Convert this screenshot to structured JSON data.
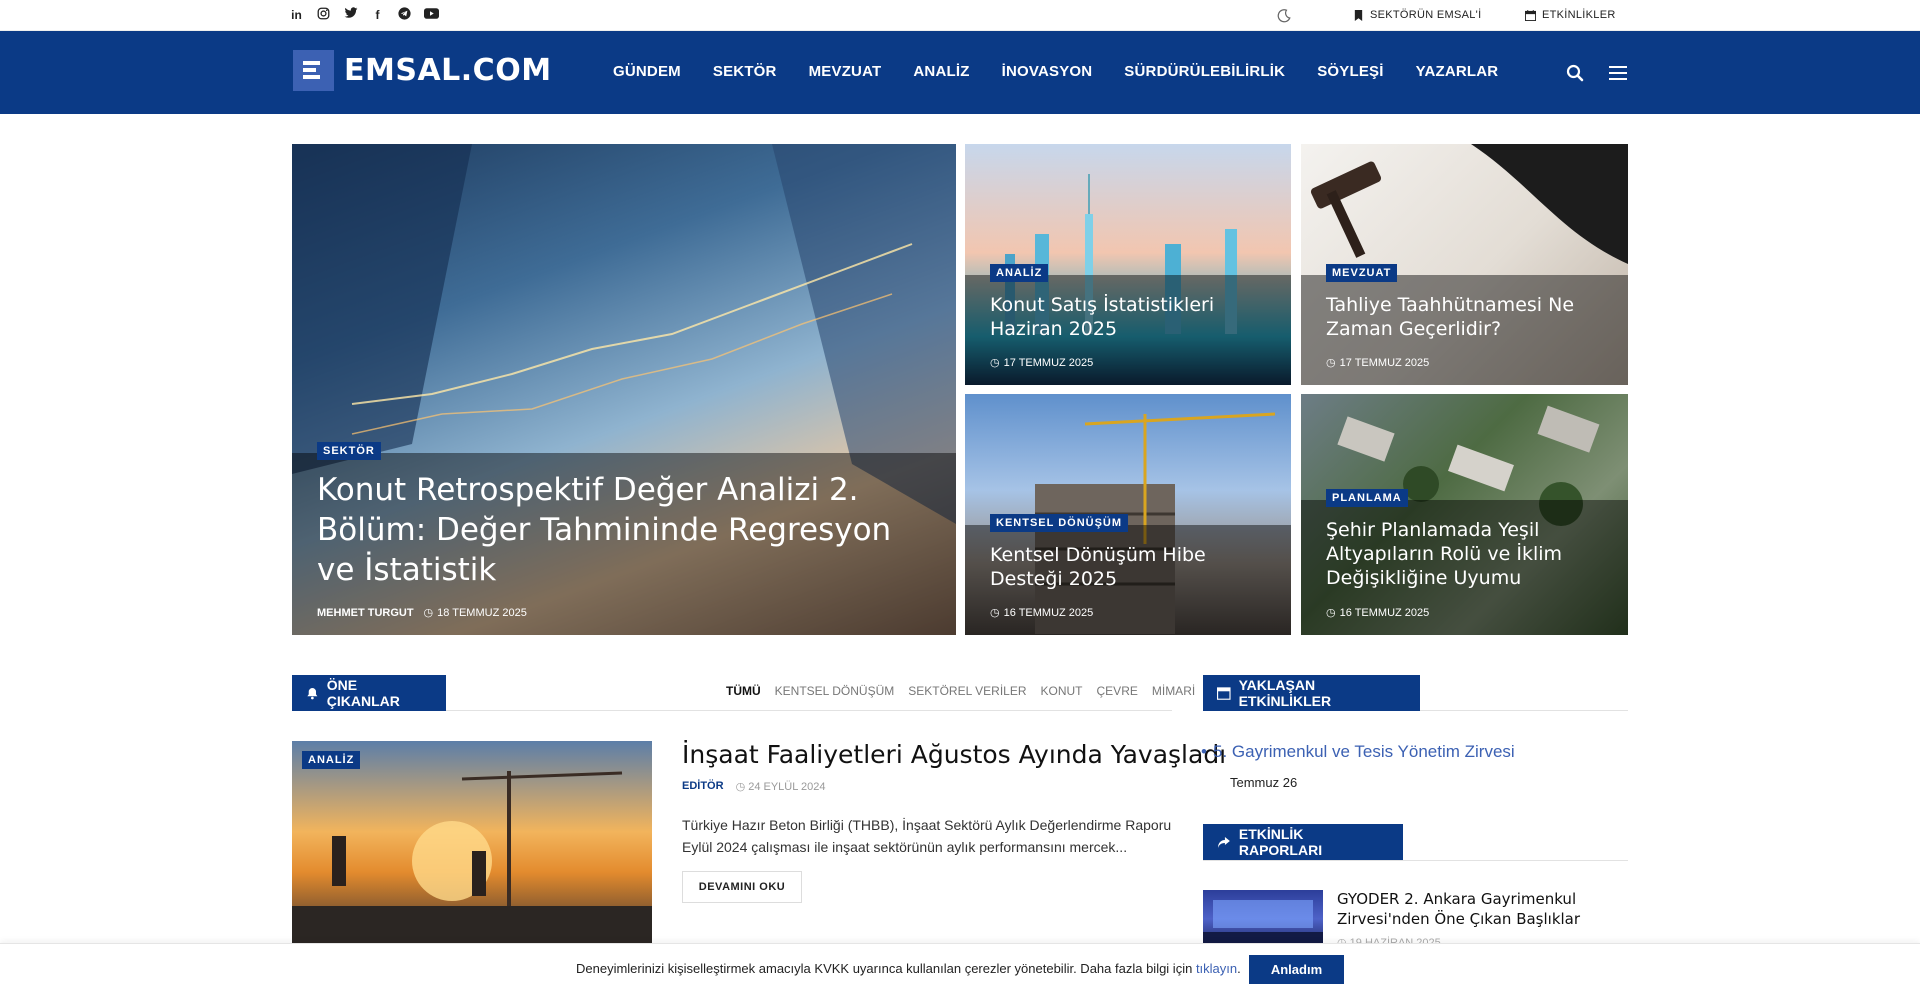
{
  "topbar": {
    "social_icons": [
      "linkedin-icon",
      "instagram-icon",
      "twitter-icon",
      "facebook-icon",
      "telegram-icon",
      "youtube-icon"
    ],
    "links": [
      {
        "label": "SEKTÖRÜN EMSAL'İ",
        "icon": "bookmark-icon"
      },
      {
        "label": "ETKİNLİKLER",
        "icon": "calendar-icon"
      }
    ]
  },
  "header": {
    "logo_text": "EMSAL.COM",
    "nav": [
      "GÜNDEM",
      "SEKTÖR",
      "MEVZUAT",
      "ANALİZ",
      "İNOVASYON",
      "SÜRDÜRÜLEBİLİRLİK",
      "SÖYLEŞİ",
      "YAZARLAR"
    ],
    "brand_color": "#0b3a86",
    "accent_color": "#3c61b3"
  },
  "hero": {
    "main": {
      "category": "SEKTÖR",
      "title": "Konut Retrospektif Değer Analizi 2. Bölüm: Değer Tahmininde Regresyon ve İstatistik",
      "author": "MEHMET TURGUT",
      "date": "18 TEMMUZ 2025"
    },
    "cards": [
      {
        "category": "ANALİZ",
        "title": "Konut Satış İstatistikleri Haziran 2025",
        "date": "17 TEMMUZ 2025"
      },
      {
        "category": "MEVZUAT",
        "title": "Tahliye Taahhütnamesi Ne Zaman Geçerlidir?",
        "date": "17 TEMMUZ 2025"
      },
      {
        "category": "KENTSEL DÖNÜŞÜM",
        "title": "Kentsel Dönüşüm Hibe Desteği 2025",
        "date": "16 TEMMUZ 2025"
      },
      {
        "category": "PLANLAMA",
        "title": "Şehir Planlamada Yeşil Altyapıların Rolü ve İklim Değişikliğine Uyumu",
        "date": "16 TEMMUZ 2025"
      }
    ]
  },
  "featured": {
    "heading": "ÖNE ÇIKANLAR",
    "filters": [
      "TÜMÜ",
      "KENTSEL DÖNÜŞÜM",
      "SEKTÖREL VERİLER",
      "KONUT",
      "ÇEVRE",
      "MİMARİ"
    ],
    "article": {
      "category": "ANALİZ",
      "title": "İnşaat Faaliyetleri Ağustos Ayında Yavaşladı",
      "author": "EDİTÖR",
      "date": "24 EYLÜL 2024",
      "excerpt": "Türkiye Hazır Beton Birliği (THBB), İnşaat Sektörü Aylık Değerlendirme Raporu Eylül 2024 çalışması ile inşaat sektörünün aylık performansını mercek...",
      "more_label": "DEVAMINI OKU"
    }
  },
  "sidebar": {
    "events_heading": "YAKLAŞAN ETKİNLİKLER",
    "event": {
      "title": "5. Gayrimenkul ve Tesis Yönetim Zirvesi",
      "date": "Temmuz 26"
    },
    "reports_heading": "ETKİNLİK RAPORLARI",
    "report": {
      "title": "GYODER 2. Ankara Gayrimenkul Zirvesi'nden Öne Çıkan Başlıklar",
      "date": "19 HAZİRAN 2025"
    }
  },
  "cookie": {
    "text": "Deneyimlerinizi kişiselleştirmek amacıyla KVKK uyarınca kullanılan çerezler yönetebilir. Daha fazla bilgi için ",
    "link": "tıklayın",
    "suffix": ".",
    "button": "Anladım"
  }
}
